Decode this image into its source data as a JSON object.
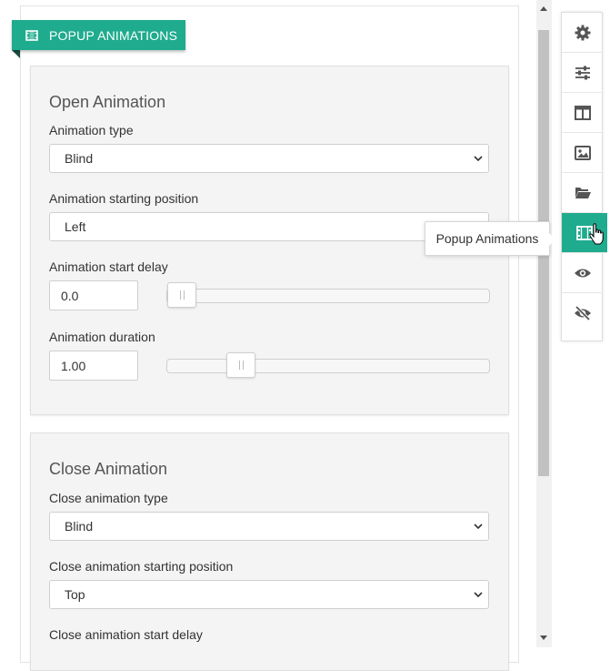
{
  "header": {
    "title": "POPUP ANIMATIONS",
    "icon": "film-icon"
  },
  "open_section": {
    "title": "Open Animation",
    "type_label": "Animation type",
    "type_value": "Blind",
    "position_label": "Animation starting position",
    "position_value": "Left",
    "delay_label": "Animation start delay",
    "delay_value": "0.0",
    "delay_slider_fraction": 0.0,
    "duration_label": "Animation duration",
    "duration_value": "1.00",
    "duration_slider_fraction": 0.2
  },
  "close_section": {
    "title": "Close Animation",
    "type_label": "Close animation type",
    "type_value": "Blind",
    "position_label": "Close animation starting position",
    "position_value": "Top",
    "delay_label": "Close animation start delay"
  },
  "toolbar": {
    "items": [
      "gear-icon",
      "sliders-icon",
      "layout-icon",
      "image-icon",
      "folder-open-icon",
      "film-icon",
      "eye-icon",
      "eye-slash-icon"
    ],
    "active_index": 5,
    "tooltip": "Popup Animations"
  },
  "colors": {
    "accent": "#1fab8e",
    "section_bg": "#f4f4f4",
    "icon": "#555555"
  }
}
